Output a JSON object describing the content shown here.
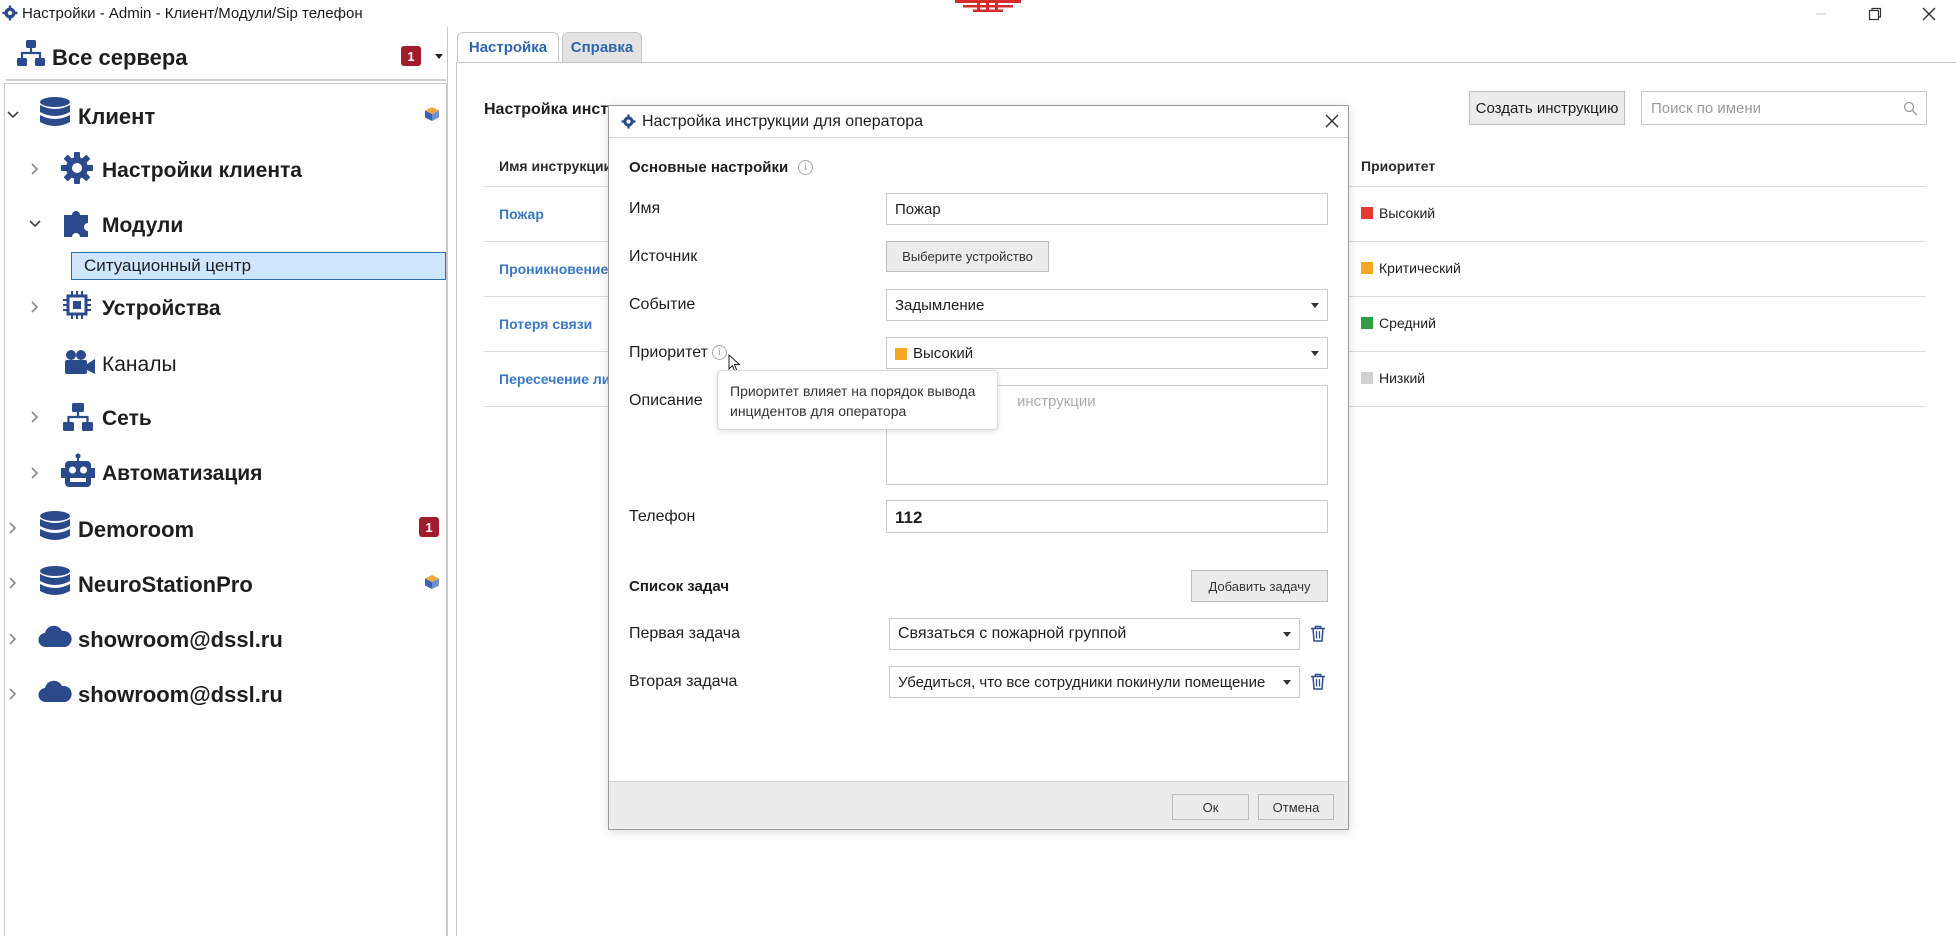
{
  "window": {
    "title": "Настройки - Admin - Клиент/Модули/Sip телефон"
  },
  "tree": {
    "header": {
      "label": "Все сервера",
      "badge": "1"
    },
    "items": [
      {
        "label": "Клиент"
      },
      {
        "label": "Настройки клиента"
      },
      {
        "label": "Модули"
      },
      {
        "label": "Ситуационный центр"
      },
      {
        "label": "Устройства"
      },
      {
        "label": "Каналы"
      },
      {
        "label": "Сеть"
      },
      {
        "label": "Автоматизация"
      },
      {
        "label": "Demoroom",
        "badge": "1"
      },
      {
        "label": "NeuroStationPro"
      },
      {
        "label": "showroom@dssl.ru"
      },
      {
        "label": "showroom@dssl.ru"
      }
    ]
  },
  "tabs": [
    {
      "label": "Настройка"
    },
    {
      "label": "Справка"
    }
  ],
  "panel": {
    "title": "Настройка инстр",
    "create_label": "Создать инструкцию",
    "search_placeholder": "Поиск по имени",
    "columns": {
      "name": "Имя инструкции",
      "priority": "Приоритет"
    },
    "rows": [
      {
        "name": "Пожар",
        "priority": "Высокий",
        "color": "#e53935"
      },
      {
        "name": "Проникновение",
        "priority": "Критический",
        "color": "#f5a623"
      },
      {
        "name": "Потеря связи",
        "priority": "Средний",
        "color": "#2e9e44"
      },
      {
        "name": "Пересечение ли",
        "priority": "Низкий",
        "color": "#d0d0d0"
      }
    ]
  },
  "modal": {
    "title": "Настройка инструкции для оператора",
    "section_main": "Основные настройки",
    "labels": {
      "name": "Имя",
      "source": "Источник",
      "event": "Событие",
      "priority": "Приоритет",
      "description": "Описание",
      "phone": "Телефон"
    },
    "values": {
      "name": "Пожар",
      "source_button": "Выберите устройство",
      "event": "Задымление",
      "priority": "Высокий",
      "priority_color": "#f5a623",
      "description_placeholder": "инструкции",
      "phone": "112"
    },
    "tooltip": "Приоритет влияет на порядок вывода инцидентов для оператора",
    "tasks": {
      "title": "Список задач",
      "add_label": "Добавить задачу",
      "items": [
        {
          "label": "Первая задача",
          "value": "Связаться с пожарной группой"
        },
        {
          "label": "Вторая задача",
          "value": "Убедиться, что все сотрудники покинули помещение"
        }
      ]
    },
    "ok_label": "Ок",
    "cancel_label": "Отмена"
  },
  "colors": {
    "accent": "#3066b0",
    "badge": "#a31c2b",
    "selection_bg": "#cfe6ff",
    "icon_navy": "#2b4a8c"
  }
}
